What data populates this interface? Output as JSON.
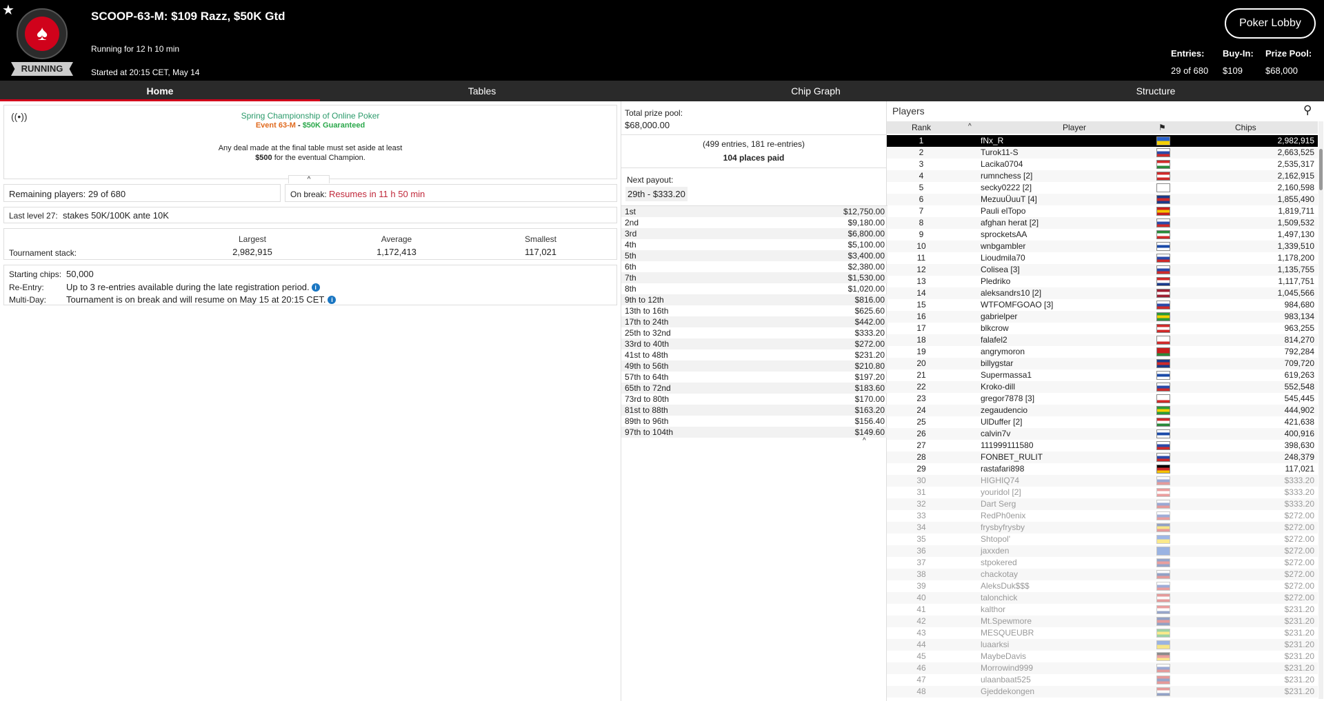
{
  "header": {
    "title": "SCOOP-63-M: $109 Razz, $50K Gtd",
    "running_for": "Running for 12 h 10 min",
    "started_at": "Started at 20:15 CET, May 14",
    "status": "RUNNING",
    "lobby_button": "Poker Lobby",
    "entries_label": "Entries:",
    "entries_value": "29 of 680",
    "buyin_label": "Buy-In:",
    "buyin_value": "$109",
    "prizepool_label": "Prize Pool:",
    "prizepool_value": "$68,000"
  },
  "tabs": [
    "Home",
    "Tables",
    "Chip Graph",
    "Structure"
  ],
  "home": {
    "series_name": "Spring Championship of Online Poker",
    "event_code": "Event 63-M",
    "event_sep": " - ",
    "event_gtd": "$50K Guaranteed",
    "deal_note_1": "Any deal made at the final table must set aside at least",
    "deal_amount": "$500",
    "deal_note_2": " for the eventual Champion.",
    "remaining": "Remaining players: 29 of 680",
    "on_break_label": "On break:",
    "on_break_value": "Resumes in 11 h 50 min",
    "last_level_label": "Last level 27:",
    "last_level_value": "stakes 50K/100K ante 10K",
    "stack_label": "Tournament stack:",
    "largest_label": "Largest",
    "largest_value": "2,982,915",
    "average_label": "Average",
    "average_value": "1,172,413",
    "smallest_label": "Smallest",
    "smallest_value": "117,021",
    "starting_chips_label": "Starting chips:",
    "starting_chips_value": "50,000",
    "reentry_label": "Re-Entry:",
    "reentry_value": "Up to 3 re-entries available during the late registration period.",
    "multiday_label": "Multi-Day:",
    "multiday_value": "Tournament is on break and will resume on May 15 at 20:15 CET."
  },
  "payouts": {
    "total_label": "Total prize pool:",
    "total_value": "$68,000.00",
    "entries_line": "(499 entries, 181 re-entries)",
    "places_paid": "104 places paid",
    "next_label": "Next payout:",
    "next_value": "29th - $333.20",
    "rows": [
      [
        "1st",
        "$12,750.00"
      ],
      [
        "2nd",
        "$9,180.00"
      ],
      [
        "3rd",
        "$6,800.00"
      ],
      [
        "4th",
        "$5,100.00"
      ],
      [
        "5th",
        "$3,400.00"
      ],
      [
        "6th",
        "$2,380.00"
      ],
      [
        "7th",
        "$1,530.00"
      ],
      [
        "8th",
        "$1,020.00"
      ],
      [
        "9th to 12th",
        "$816.00"
      ],
      [
        "13th to 16th",
        "$625.60"
      ],
      [
        "17th to 24th",
        "$442.00"
      ],
      [
        "25th to 32nd",
        "$333.20"
      ],
      [
        "33rd to 40th",
        "$272.00"
      ],
      [
        "41st to 48th",
        "$231.20"
      ],
      [
        "49th to 56th",
        "$210.80"
      ],
      [
        "57th to 64th",
        "$197.20"
      ],
      [
        "65th to 72nd",
        "$183.60"
      ],
      [
        "73rd to 80th",
        "$170.00"
      ],
      [
        "81st to 88th",
        "$163.20"
      ],
      [
        "89th to 96th",
        "$156.40"
      ],
      [
        "97th to 104th",
        "$149.60"
      ]
    ]
  },
  "players": {
    "title": "Players",
    "col_rank": "Rank",
    "col_player": "Player",
    "col_chips": "Chips",
    "rows": [
      [
        1,
        "fNx_R",
        "2,982,915",
        [
          "#2a62c9",
          "#f5d000"
        ]
      ],
      [
        2,
        "Turok11-S",
        "2,663,525",
        [
          "#fff",
          "#2a4aa8",
          "#d02a2a"
        ]
      ],
      [
        3,
        "Lacika0704",
        "2,535,317",
        [
          "#d02a2a",
          "#fff",
          "#2a8a3a"
        ]
      ],
      [
        4,
        "rumnchess [2]",
        "2,162,915",
        [
          "#d02a2a",
          "#fff",
          "#d02a2a"
        ]
      ],
      [
        5,
        "secky0222 [2]",
        "2,160,598",
        [
          "#fff",
          "#fff",
          "#fff"
        ]
      ],
      [
        6,
        "MezuuÜuuT [4]",
        "1,855,490",
        [
          "#1a3a8a",
          "#d02a2a",
          "#1a3a8a"
        ]
      ],
      [
        7,
        "Pauli elTopo",
        "1,819,711",
        [
          "#c81e1e",
          "#f5c400",
          "#c81e1e"
        ]
      ],
      [
        8,
        "afghan herat [2]",
        "1,509,532",
        [
          "#fff",
          "#2a4aa8",
          "#d02a2a"
        ]
      ],
      [
        9,
        "sprocketsAA",
        "1,497,130",
        [
          "#2a8a3a",
          "#fff",
          "#d02a2a"
        ]
      ],
      [
        10,
        "wnbgambler",
        "1,339,510",
        [
          "#fff",
          "#1a4aa8",
          "#fff"
        ]
      ],
      [
        11,
        "Lioudmila70",
        "1,178,200",
        [
          "#fff",
          "#2a4aa8",
          "#d02a2a"
        ]
      ],
      [
        12,
        "Colisea [3]",
        "1,135,755",
        [
          "#fff",
          "#2a4aa8",
          "#d02a2a"
        ]
      ],
      [
        13,
        "Pledriko",
        "1,117,751",
        [
          "#d02a2a",
          "#fff",
          "#1a3a8a"
        ]
      ],
      [
        14,
        "aleksandrs10 [2]",
        "1,045,566",
        [
          "#9e1e32",
          "#fff",
          "#9e1e32"
        ]
      ],
      [
        15,
        "WTFOMFGOAO [3]",
        "984,680",
        [
          "#fff",
          "#2a4aa8",
          "#d02a2a"
        ]
      ],
      [
        16,
        "gabrielper",
        "983,134",
        [
          "#2a9a3a",
          "#f5d000",
          "#2a9a3a"
        ]
      ],
      [
        17,
        "blkcrow",
        "963,255",
        [
          "#d02a2a",
          "#fff",
          "#d02a2a"
        ]
      ],
      [
        18,
        "falafel2",
        "814,270",
        [
          "#fff",
          "#fff",
          "#d02a2a"
        ]
      ],
      [
        19,
        "angrymoron",
        "792,284",
        [
          "#c81e1e",
          "#c81e1e",
          "#2a8a3a"
        ]
      ],
      [
        20,
        "billygstar",
        "709,720",
        [
          "#1a3a8a",
          "#d02a2a",
          "#1a3a8a"
        ]
      ],
      [
        21,
        "Supermassa1",
        "619,263",
        [
          "#fff",
          "#1a4aa8",
          "#fff"
        ]
      ],
      [
        22,
        "Kroko-dill",
        "552,548",
        [
          "#fff",
          "#2a4aa8",
          "#d02a2a"
        ]
      ],
      [
        23,
        "gregor7878 [3]",
        "545,445",
        [
          "#fff",
          "#fff",
          "#d02a2a"
        ]
      ],
      [
        24,
        "zegaudencio",
        "444,902",
        [
          "#2a9a3a",
          "#f5d000",
          "#2a9a3a"
        ]
      ],
      [
        25,
        "UlDuffer [2]",
        "421,638",
        [
          "#d02a2a",
          "#fff",
          "#2a8a3a"
        ]
      ],
      [
        26,
        "calvin7v",
        "400,916",
        [
          "#fff",
          "#1a4aa8",
          "#fff"
        ]
      ],
      [
        27,
        "111999111580",
        "398,630",
        [
          "#fff",
          "#2a4aa8",
          "#d02a2a"
        ]
      ],
      [
        28,
        "FONBET_RULIT",
        "248,379",
        [
          "#fff",
          "#2a4aa8",
          "#d02a2a"
        ]
      ],
      [
        29,
        "rastafari898",
        "117,021",
        [
          "#000",
          "#d02a2a",
          "#f5c400"
        ]
      ],
      [
        30,
        "HIGHIQ74",
        "$333.20",
        [
          "#fff",
          "#2a4aa8",
          "#d02a2a"
        ]
      ],
      [
        31,
        "youridol [2]",
        "$333.20",
        [
          "#d02a2a",
          "#fff",
          "#d02a2a"
        ]
      ],
      [
        32,
        "Dart Serg",
        "$333.20",
        [
          "#fff",
          "#2a4aa8",
          "#d02a2a"
        ]
      ],
      [
        33,
        "RedPh0enix",
        "$272.00",
        [
          "#fff",
          "#2a4aa8",
          "#d02a2a"
        ]
      ],
      [
        34,
        "frysbyfrysby",
        "$272.00",
        [
          "#1a3a8a",
          "#f5d000",
          "#d02a2a"
        ]
      ],
      [
        35,
        "Shtopol'",
        "$272.00",
        [
          "#2a62c9",
          "#f5d000"
        ]
      ],
      [
        36,
        "jaxxden",
        "$272.00",
        [
          "#2a62c9",
          "#2a62c9",
          "#2a62c9"
        ]
      ],
      [
        37,
        "stpokered",
        "$272.00",
        [
          "#1a3a8a",
          "#d02a2a",
          "#1a3a8a"
        ]
      ],
      [
        38,
        "chackotay",
        "$272.00",
        [
          "#fff",
          "#1a3a8a",
          "#d02a2a"
        ]
      ],
      [
        39,
        "AleksDuk$$$",
        "$272.00",
        [
          "#fff",
          "#2a4aa8",
          "#d02a2a"
        ]
      ],
      [
        40,
        "talonchick",
        "$272.00",
        [
          "#d02a2a",
          "#fff",
          "#d02a2a"
        ]
      ],
      [
        41,
        "kalthor",
        "$231.20",
        [
          "#d02a2a",
          "#fff",
          "#1a3a8a"
        ]
      ],
      [
        42,
        "Mt.Spewmore",
        "$231.20",
        [
          "#1a3a8a",
          "#d02a2a",
          "#1a3a8a"
        ]
      ],
      [
        43,
        "MESQUEUBR",
        "$231.20",
        [
          "#2a9a3a",
          "#f5d000",
          "#2a9a3a"
        ]
      ],
      [
        44,
        "luaarksi",
        "$231.20",
        [
          "#2a62c9",
          "#f5d000"
        ]
      ],
      [
        45,
        "MaybeDavis",
        "$231.20",
        [
          "#000",
          "#d02a2a",
          "#f5c400"
        ]
      ],
      [
        46,
        "Morrowind999",
        "$231.20",
        [
          "#fff",
          "#2a4aa8",
          "#d02a2a"
        ]
      ],
      [
        47,
        "ulaanbaat525",
        "$231.20",
        [
          "#c81e1e",
          "#1a3a8a",
          "#c81e1e"
        ]
      ],
      [
        48,
        "Gjeddekongen",
        "$231.20",
        [
          "#d02a2a",
          "#fff",
          "#1a3a8a"
        ]
      ]
    ]
  }
}
